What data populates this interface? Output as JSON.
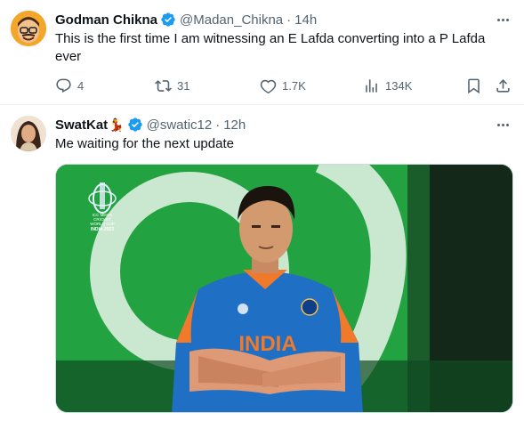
{
  "tweets": [
    {
      "display_name": "Godman Chikna",
      "handle": "@Madan_Chikna",
      "separator": "·",
      "time": "14h",
      "text": "This is the first time I am witnessing an E Lafda converting into a P Lafda ever",
      "replies": "4",
      "retweets": "31",
      "likes": "1.7K",
      "views": "134K"
    },
    {
      "display_name": "SwatKat",
      "name_emoji": "💃",
      "handle": "@swatic12",
      "separator": "·",
      "time": "12h",
      "text": "Me waiting for the next update",
      "media": {
        "logo_lines": [
          "ICC MEN'S",
          "CRICKET",
          "WORLD CUP",
          "INDIA 2023"
        ],
        "jersey_text": "INDIA"
      }
    }
  ],
  "colors": {
    "verified": "#1d9bf0",
    "secondary_text": "#536471",
    "stadium_green": "#1f9a3a",
    "jersey_blue": "#1f6fc5"
  }
}
